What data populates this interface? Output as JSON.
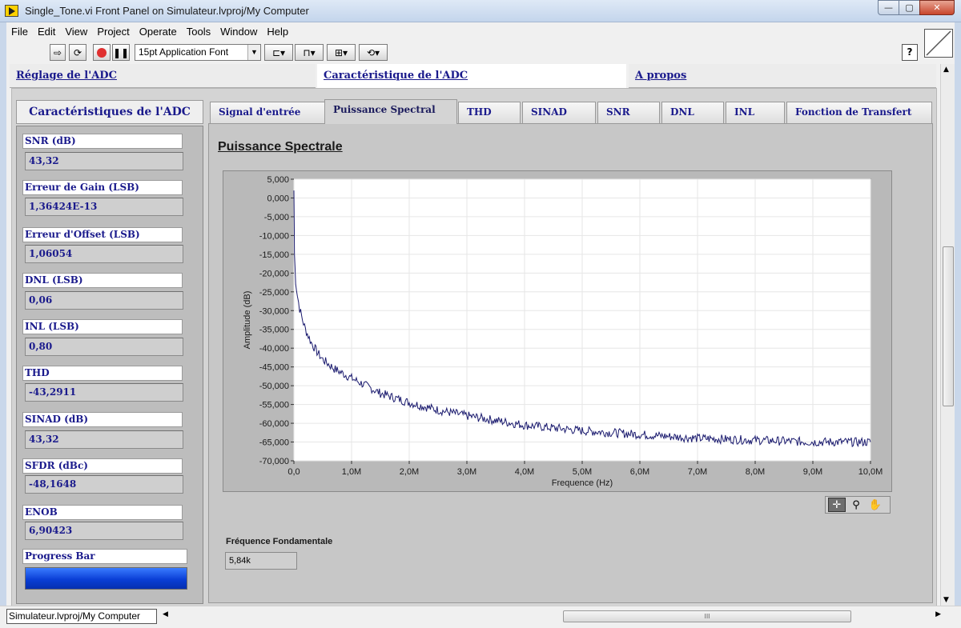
{
  "window": {
    "title": "Single_Tone.vi Front Panel on Simulateur.lvproj/My Computer",
    "min_label": "—",
    "max_label": "▢",
    "close_label": "✕"
  },
  "menu": [
    "File",
    "Edit",
    "View",
    "Project",
    "Operate",
    "Tools",
    "Window",
    "Help"
  ],
  "toolbar": {
    "font_select": "15pt Application Font",
    "help_label": "?"
  },
  "top_tabs": [
    "Réglage de l'ADC",
    "Caractéristique de l'ADC",
    "A propos"
  ],
  "sidebar": {
    "title": "Caractéristiques de l'ADC",
    "metrics": [
      {
        "label": "SNR (dB)",
        "value": "43,32"
      },
      {
        "label": "Erreur de Gain (LSB)",
        "value": "1,36424E-13"
      },
      {
        "label": "Erreur d'Offset (LSB)",
        "value": "1,06054"
      },
      {
        "label": "DNL  (LSB)",
        "value": "0,06"
      },
      {
        "label": "INL (LSB)",
        "value": "0,80"
      },
      {
        "label": "THD",
        "value": "-43,2911"
      },
      {
        "label": "SINAD (dB)",
        "value": "43,32"
      },
      {
        "label": "SFDR (dBc)",
        "value": "-48,1648"
      },
      {
        "label": "ENOB",
        "value": "6,90423"
      }
    ],
    "progress_label": "Progress Bar",
    "progress_fraction": 1.0,
    "progress_color": "#0a3fd6"
  },
  "inner_tabs": [
    "Signal d'entrée",
    "Puissance Spectral",
    "THD",
    "SINAD",
    "SNR",
    "DNL",
    "INL",
    "Fonction de Transfert"
  ],
  "inner_tab_active": 1,
  "section_title": "Puissance Spectrale",
  "fundamental": {
    "label": "Fréquence Fondamentale",
    "value": "5,84k"
  },
  "status": {
    "project": "Simulateur.lvproj/My Computer"
  },
  "chart_data": {
    "type": "line",
    "xlabel": "Frequence (Hz)",
    "ylabel": "Amplitude (dB)",
    "xlim": [
      0,
      10000000
    ],
    "ylim": [
      -70000,
      5000
    ],
    "xticks": [
      "0,0",
      "1,0M",
      "2,0M",
      "3,0M",
      "4,0M",
      "5,0M",
      "6,0M",
      "7,0M",
      "8,0M",
      "9,0M",
      "10,0M"
    ],
    "yticks": [
      "5,000",
      "0,000",
      "-5,000",
      "-10,000",
      "-15,000",
      "-20,000",
      "-25,000",
      "-30,000",
      "-35,000",
      "-40,000",
      "-45,000",
      "-50,000",
      "-55,000",
      "-60,000",
      "-65,000",
      "-70,000"
    ],
    "grid": true,
    "line_color": "#1a1a6e",
    "series": [
      {
        "x": [
          0,
          10000,
          30000,
          60000,
          100000,
          150000,
          200000,
          300000,
          400000,
          500000,
          700000,
          1000000,
          1500000,
          2000000,
          2500000,
          3000000,
          4000000,
          5000000,
          6000000,
          7000000,
          8000000,
          9000000,
          10000000
        ],
        "y": [
          2000,
          -15000,
          -22000,
          -26000,
          -29500,
          -32500,
          -35000,
          -38500,
          -41000,
          -43000,
          -45500,
          -48000,
          -52000,
          -54500,
          -56500,
          -58000,
          -60500,
          -62000,
          -63000,
          -64000,
          -64500,
          -65000,
          -65000
        ]
      }
    ]
  }
}
